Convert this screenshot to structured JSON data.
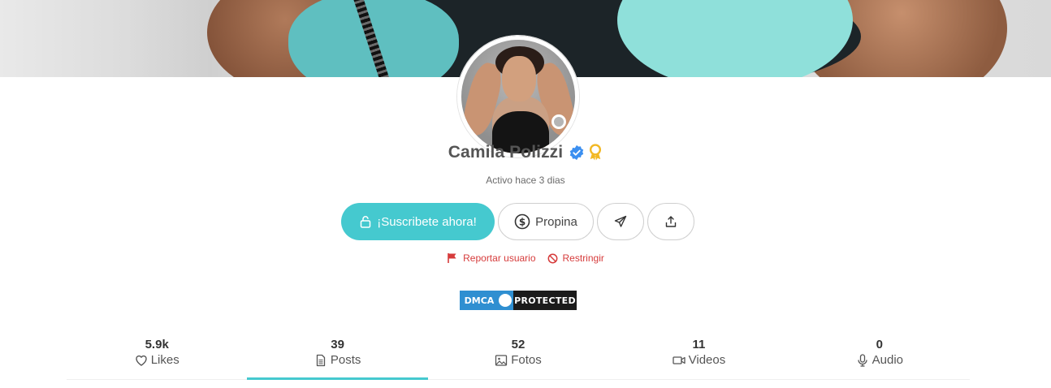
{
  "profile": {
    "name": "Camila Polizzi",
    "activity": "Activo hace 3 dias"
  },
  "actions": {
    "subscribe_label": "¡Suscribete ahora!",
    "tip_label": "Propina"
  },
  "report": {
    "report_label": "Reportar usuario",
    "restrict_label": "Restringir"
  },
  "dmca": {
    "left": "DMCA",
    "right": "PROTECTED"
  },
  "stats": [
    {
      "count": "5.9k",
      "label": "Likes",
      "icon": "heart-icon"
    },
    {
      "count": "39",
      "label": "Posts",
      "icon": "document-icon"
    },
    {
      "count": "52",
      "label": "Fotos",
      "icon": "image-icon"
    },
    {
      "count": "11",
      "label": "Videos",
      "icon": "video-icon"
    },
    {
      "count": "0",
      "label": "Audio",
      "icon": "microphone-icon"
    }
  ],
  "active_tab": "Posts",
  "colors": {
    "accent": "#45c9cf",
    "verified": "#3b8ff0",
    "award": "#f2b824",
    "danger": "#d63b3b"
  }
}
